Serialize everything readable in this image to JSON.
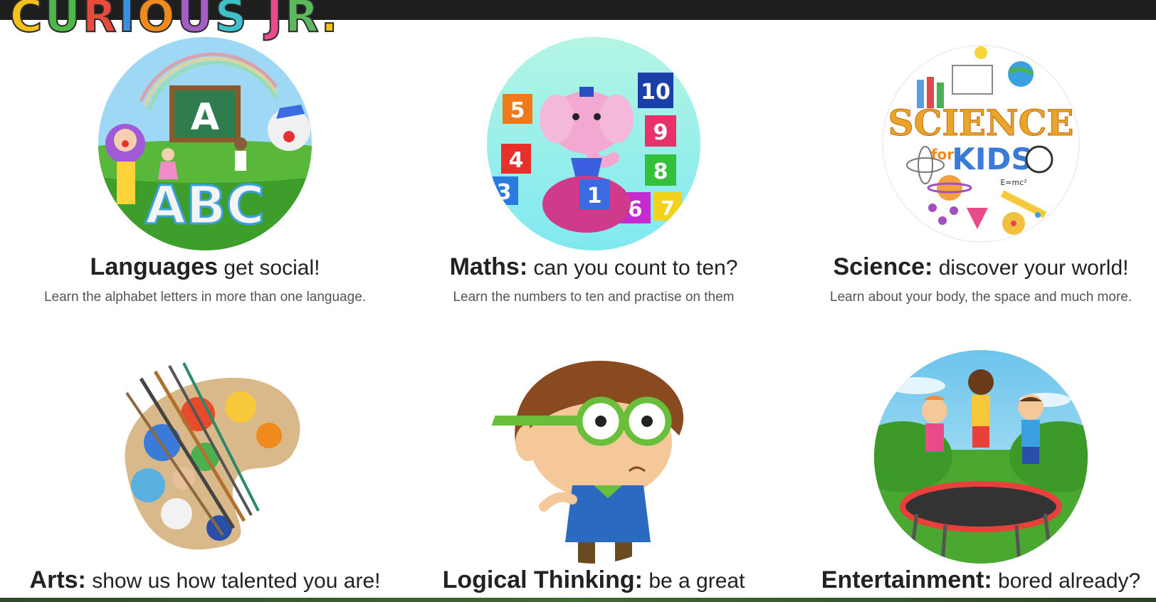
{
  "header": {
    "logo_text": "CURIOUS JR.",
    "logo_colors": [
      "#f2c21b",
      "#4db848",
      "#e84a3c",
      "#3b8fe0",
      "#f08a1c",
      "#a25ec5",
      "#3ec0c9",
      "#e84a8a",
      "#5cb85c",
      "#f2c21b",
      "#e84a3c"
    ]
  },
  "categories": [
    {
      "title": "Languages",
      "tagline": " get social!",
      "description": "Learn the alphabet letters in more than one language.",
      "image_icon": "abc-language-illustration"
    },
    {
      "title": "Maths:",
      "tagline": " can you count to ten?",
      "description": "Learn the numbers to ten and practise on them",
      "image_icon": "elephant-number-blocks-illustration"
    },
    {
      "title": "Science:",
      "tagline": " discover your world!",
      "description": "Learn about your body, the space and much more.",
      "image_icon": "science-for-kids-illustration"
    },
    {
      "title": "Arts:",
      "tagline": " show us how talented you are!",
      "description": "",
      "image_icon": "paint-palette-illustration"
    },
    {
      "title": "Logical Thinking:",
      "tagline": " be a great",
      "description": "",
      "image_icon": "thinking-boy-illustration"
    },
    {
      "title": "Entertainment:",
      "tagline": " bored already?",
      "description": "",
      "image_icon": "trampoline-kids-illustration"
    }
  ],
  "image_text": {
    "abc_letters": "ABC",
    "board_letter": "A",
    "math_numbers": [
      "10",
      "9",
      "8",
      "7",
      "6",
      "5",
      "4",
      "3",
      "1"
    ],
    "science_word": "SCIENCE",
    "science_for": "for",
    "science_kids": "KIDS",
    "science_formula": "E=mc²"
  }
}
